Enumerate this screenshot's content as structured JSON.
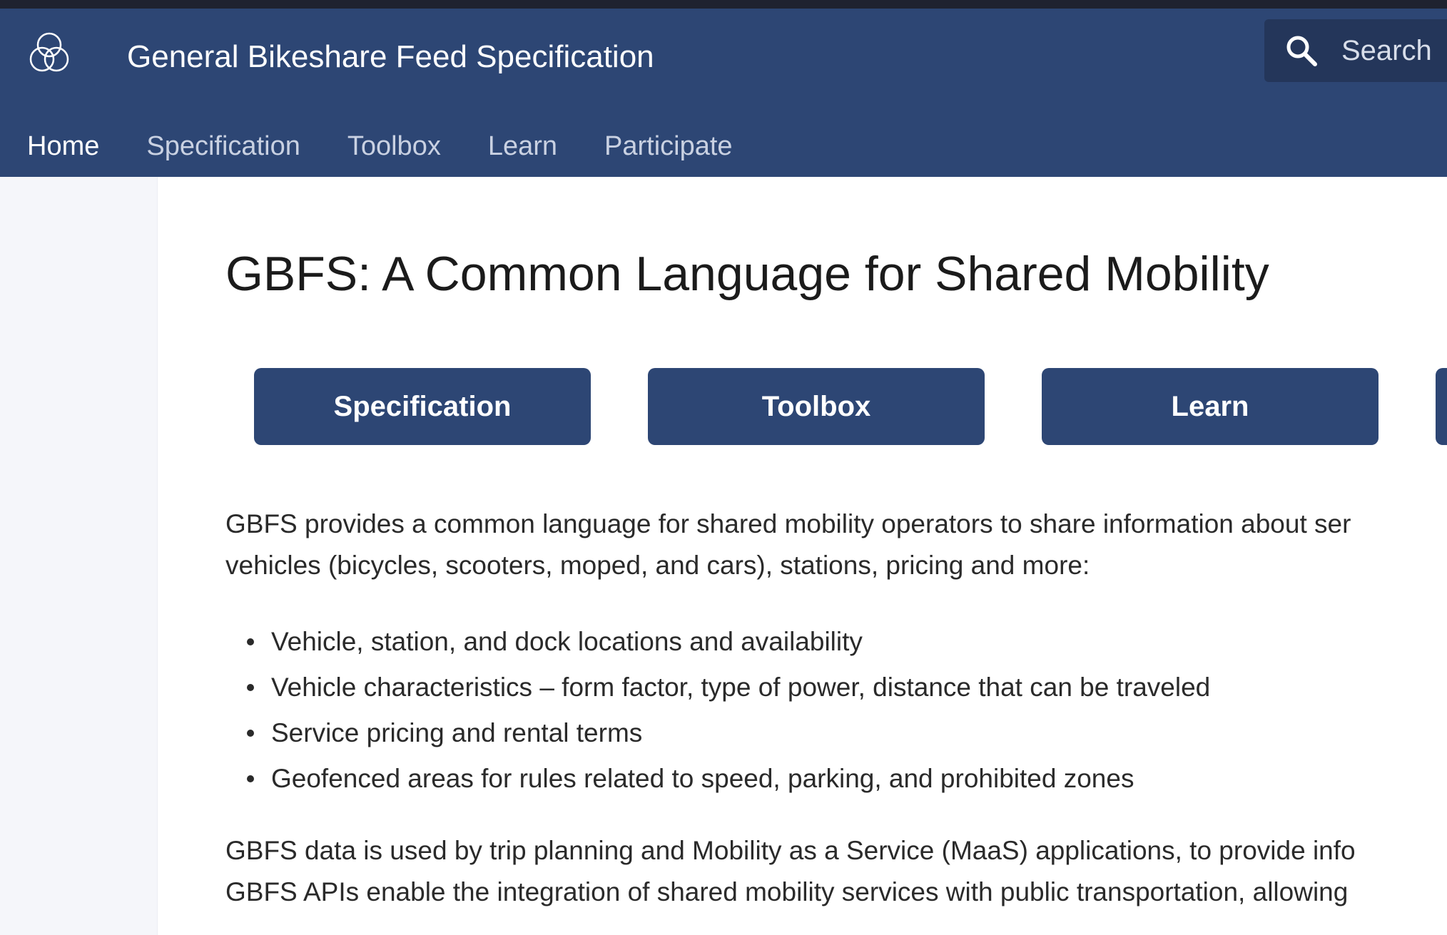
{
  "header": {
    "site_title": "General Bikeshare Feed Specification",
    "logo_icon": "triple-circle-logo-icon",
    "search": {
      "placeholder": "Search",
      "icon": "search-icon"
    },
    "nav": [
      {
        "label": "Home",
        "active": true
      },
      {
        "label": "Specification",
        "active": false
      },
      {
        "label": "Toolbox",
        "active": false
      },
      {
        "label": "Learn",
        "active": false
      },
      {
        "label": "Participate",
        "active": false
      }
    ]
  },
  "main": {
    "title": "GBFS: A Common Language for Shared Mobility",
    "buttons": [
      {
        "label": "Specification"
      },
      {
        "label": "Toolbox"
      },
      {
        "label": "Learn"
      },
      {
        "label": ""
      }
    ],
    "intro_line1": "GBFS provides a common language for shared mobility operators to share information about ser",
    "intro_line2": "vehicles (bicycles, scooters, moped, and cars), stations, pricing and more:",
    "features": [
      "Vehicle, station, and dock locations and availability",
      "Vehicle characteristics – form factor, type of power, distance that can be traveled",
      "Service pricing and rental terms",
      "Geofenced areas for rules related to speed, parking, and prohibited zones"
    ],
    "usage_line1": "GBFS data is used by trip planning and Mobility as a Service (MaaS) applications, to provide info",
    "usage_line2": "GBFS APIs enable the integration of shared mobility services with public transportation, allowing"
  },
  "colors": {
    "header_bg": "#2d4674",
    "search_bg": "#24365a",
    "button_bg": "#2d4674",
    "sidebar_bg": "#f5f6fa",
    "nav_inactive": "#c9d1e2",
    "nav_active": "#ffffff"
  }
}
